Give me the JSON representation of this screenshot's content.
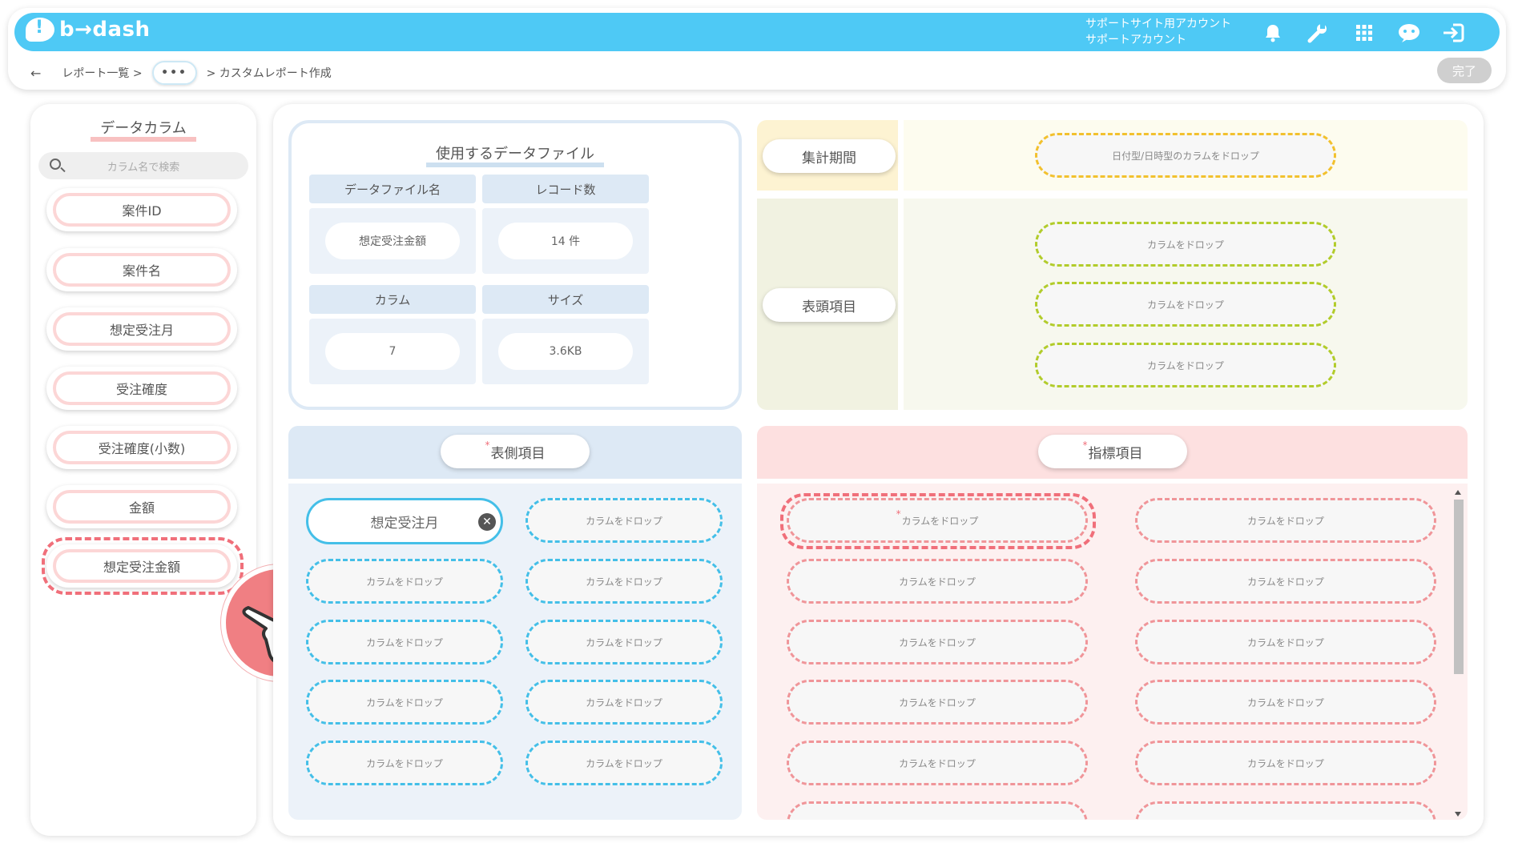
{
  "app": {
    "logo_text": "b→dash"
  },
  "header": {
    "account_line1": "サポートサイト用アカウント",
    "account_line2": "サポートアカウント",
    "icons": [
      "bell-icon",
      "wrench-icon",
      "grid-icon",
      "chat-bot-icon",
      "logout-icon"
    ]
  },
  "breadcrumb": {
    "back": "←",
    "item1": "レポート一覧 >",
    "dots": "•••",
    "item2": "> カスタムレポート作成"
  },
  "done_label": "完了",
  "left_panel": {
    "title": "データカラム",
    "search_placeholder": "カラム名で検索",
    "columns": [
      "案件ID",
      "案件名",
      "想定受注月",
      "受注確度",
      "受注確度(小数)",
      "金額",
      "想定受注金額"
    ],
    "dragging_column": "想定受注金額"
  },
  "data_file": {
    "title": "使用するデータファイル",
    "headers": {
      "file_name": "データファイル名",
      "records": "レコード数",
      "columns": "カラム",
      "size": "サイズ"
    },
    "values": {
      "file_name": "想定受注金額",
      "records": "14 件",
      "columns": "7",
      "size": "3.6KB"
    }
  },
  "period": {
    "label": "集計期間",
    "drop": "日付型/日時型のカラムをドロップ"
  },
  "header_items": {
    "label": "表頭項目",
    "drops": [
      "カラムをドロップ",
      "カラムをドロップ",
      "カラムをドロップ"
    ]
  },
  "row_items": {
    "required": "*",
    "label": "表側項目",
    "filled": "想定受注月",
    "drop": "カラムをドロップ"
  },
  "metric_items": {
    "required": "*",
    "label": "指標項目",
    "drop": "カラムをドロップ"
  },
  "colors": {
    "header_blue": "#4ec9f5",
    "accent_red": "#f06f7a",
    "row_blue": "#44bfe8",
    "head_green": "#b2cc2b",
    "period_yellow": "#f2c12e"
  }
}
